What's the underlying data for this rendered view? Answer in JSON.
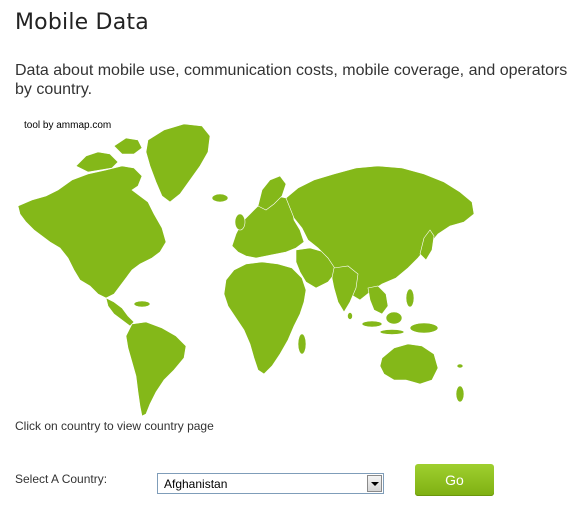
{
  "page": {
    "title": "Mobile Data",
    "intro": "Data about mobile use, communication costs, mobile coverage, and operators by country."
  },
  "map": {
    "credit": "tool by ammap.com",
    "hint": "Click on country to view country page",
    "land_color": "#84b819"
  },
  "country_selector": {
    "label": "Select A Country:",
    "selected": "Afghanistan",
    "go_label": "Go"
  },
  "colors": {
    "accent": "#84b819",
    "button": "#8cc21f"
  }
}
